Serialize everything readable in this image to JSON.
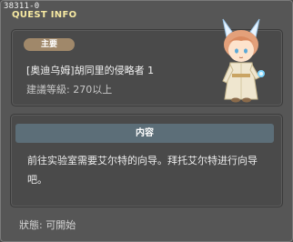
{
  "window": {
    "id_label": "38311-0",
    "title": "QUEST INFO"
  },
  "quest": {
    "category_badge": "主要",
    "name": "[奥迪乌姆]胡同里的侵略者 1",
    "required_level": "建議等級: 270以上"
  },
  "content": {
    "header": "内容",
    "description": "前往实验室需要艾尔特的向导。拜托艾尔特进行向导吧。"
  },
  "status": {
    "text": "狀態: 可開始"
  },
  "icons": {
    "npc_avatar": "npc-portrait-icon"
  }
}
